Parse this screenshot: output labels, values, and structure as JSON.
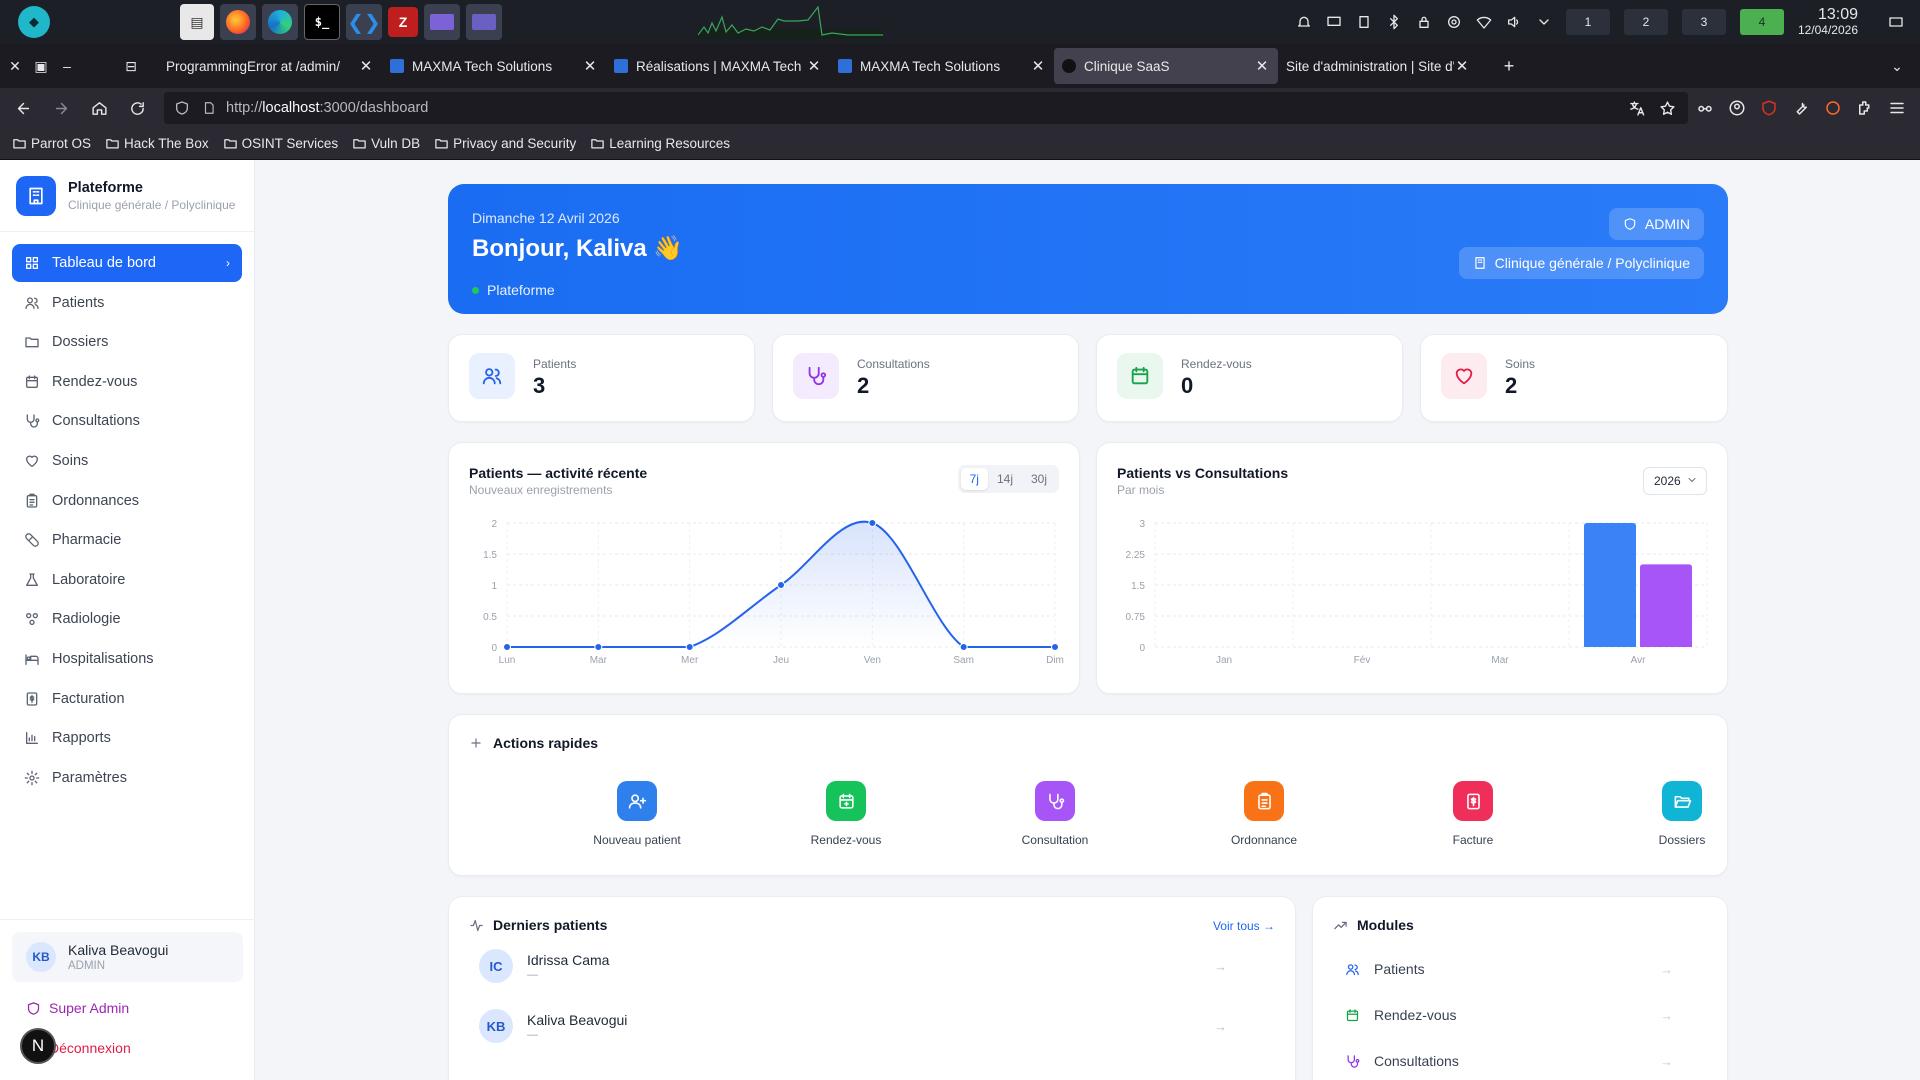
{
  "taskbar": {
    "apps": [
      "files",
      "firefox",
      "edge",
      "terminal",
      "vscode",
      "filezilla",
      "remote-desktop",
      "screen"
    ],
    "workspaces": [
      "1",
      "2",
      "3",
      "4"
    ],
    "time": "13:09",
    "date": "12/04/2026"
  },
  "browser": {
    "tabs": [
      {
        "title": "ProgrammingError at /admin/",
        "active": false
      },
      {
        "title": "MAXMA Tech Solutions",
        "active": false
      },
      {
        "title": "Réalisations | MAXMA Tech",
        "active": false
      },
      {
        "title": "MAXMA Tech Solutions",
        "active": false
      },
      {
        "title": "Clinique SaaS",
        "active": true
      },
      {
        "title": "Site d'administration | Site d'a",
        "active": false
      }
    ],
    "url_prefix": "http://",
    "url_host": "localhost",
    "url_path": ":3000/dashboard",
    "bookmarks": [
      "Parrot OS",
      "Hack The Box",
      "OSINT Services",
      "Vuln DB",
      "Privacy and Security",
      "Learning Resources"
    ]
  },
  "sidebar": {
    "brand_name": "Plateforme",
    "brand_sub": "Clinique générale / Polyclinique",
    "items": [
      {
        "label": "Tableau de bord",
        "icon": "grid-icon",
        "active": true
      },
      {
        "label": "Patients",
        "icon": "users-icon"
      },
      {
        "label": "Dossiers",
        "icon": "folder-icon"
      },
      {
        "label": "Rendez-vous",
        "icon": "calendar-icon"
      },
      {
        "label": "Consultations",
        "icon": "stethoscope-icon"
      },
      {
        "label": "Soins",
        "icon": "heart-icon"
      },
      {
        "label": "Ordonnances",
        "icon": "clipboard-icon"
      },
      {
        "label": "Pharmacie",
        "icon": "pill-icon"
      },
      {
        "label": "Laboratoire",
        "icon": "flask-icon"
      },
      {
        "label": "Radiologie",
        "icon": "radiology-icon"
      },
      {
        "label": "Hospitalisations",
        "icon": "bed-icon"
      },
      {
        "label": "Facturation",
        "icon": "receipt-icon"
      },
      {
        "label": "Rapports",
        "icon": "bar-chart-icon"
      },
      {
        "label": "Paramètres",
        "icon": "settings-icon"
      }
    ],
    "user_initials": "KB",
    "user_name": "Kaliva Beavogui",
    "user_role": "ADMIN",
    "super_admin": "Super Admin",
    "logout": "Déconnexion",
    "next_badge": "N"
  },
  "hero": {
    "date": "Dimanche 12 Avril 2026",
    "greeting": "Bonjour, Kaliva 👋",
    "site": "Plateforme",
    "role_badge": "ADMIN",
    "establishment": "Clinique générale / Polyclinique"
  },
  "stats": [
    {
      "label": "Patients",
      "value": "3",
      "icon": "users-icon",
      "color": "#2563eb",
      "bg": "#eaf1fe"
    },
    {
      "label": "Consultations",
      "value": "2",
      "icon": "stethoscope-icon",
      "color": "#9333ea",
      "bg": "#f4ecfe"
    },
    {
      "label": "Rendez-vous",
      "value": "0",
      "icon": "calendar-icon",
      "color": "#16a34a",
      "bg": "#e9f7ee"
    },
    {
      "label": "Soins",
      "value": "2",
      "icon": "heart-icon",
      "color": "#e11d48",
      "bg": "#fdecef"
    }
  ],
  "line_card": {
    "title": "Patients — activité récente",
    "subtitle": "Nouveaux enregistrements",
    "ranges": [
      "7j",
      "14j",
      "30j"
    ],
    "active_range": "7j"
  },
  "bar_card": {
    "title": "Patients vs Consultations",
    "subtitle": "Par mois",
    "year": "2026"
  },
  "chart_data": [
    {
      "type": "line",
      "title": "Patients — activité récente",
      "x": [
        "Lun",
        "Mar",
        "Mer",
        "Jeu",
        "Ven",
        "Sam",
        "Dim"
      ],
      "series": [
        {
          "values": [
            0,
            0,
            0,
            1,
            2,
            0,
            0
          ]
        }
      ],
      "yticks": [
        "0",
        "0.5",
        "1",
        "1.5",
        "2"
      ],
      "ylim": [
        0,
        2
      ],
      "grid": true,
      "color": "#2563eb"
    },
    {
      "type": "bar",
      "title": "Patients vs Consultations",
      "categories": [
        "Jan",
        "Fév",
        "Mar",
        "Avr"
      ],
      "series": [
        {
          "values": [
            0,
            0,
            0,
            3
          ],
          "color": "#3b82f6"
        },
        {
          "values": [
            0,
            0,
            0,
            2
          ],
          "color": "#a855f7"
        }
      ],
      "yticks": [
        "0",
        "0.75",
        "1.5",
        "2.25",
        "3"
      ],
      "ylim": [
        0,
        3
      ],
      "grid": true
    }
  ],
  "quick_actions": {
    "title": "Actions rapides",
    "items": [
      {
        "label": "Nouveau patient",
        "icon": "user-plus-icon",
        "color": "#2f80ed"
      },
      {
        "label": "Rendez-vous",
        "icon": "calendar-plus-icon",
        "color": "#16c25a"
      },
      {
        "label": "Consultation",
        "icon": "stethoscope-icon",
        "color": "#a855f7"
      },
      {
        "label": "Ordonnance",
        "icon": "clipboard-icon",
        "color": "#f97316"
      },
      {
        "label": "Facture",
        "icon": "receipt-icon",
        "color": "#ef2f5a"
      },
      {
        "label": "Dossiers",
        "icon": "folder-open-icon",
        "color": "#10b4d4"
      }
    ]
  },
  "latest_patients": {
    "title": "Derniers patients",
    "see_all": "Voir tous →",
    "rows": [
      {
        "initials": "IC",
        "name": "Idrissa Cama",
        "detail": "—"
      },
      {
        "initials": "KB",
        "name": "Kaliva Beavogui",
        "detail": "—"
      }
    ]
  },
  "modules": {
    "title": "Modules",
    "items": [
      {
        "label": "Patients",
        "icon": "users-icon",
        "color": "#2563eb"
      },
      {
        "label": "Rendez-vous",
        "icon": "calendar-icon",
        "color": "#16a34a"
      },
      {
        "label": "Consultations",
        "icon": "stethoscope-icon",
        "color": "#9333ea"
      }
    ]
  }
}
